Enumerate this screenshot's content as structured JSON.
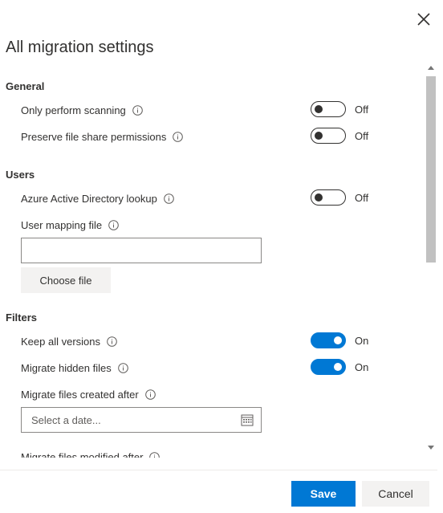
{
  "panel": {
    "title": "All migration settings"
  },
  "general": {
    "heading": "General",
    "only_scanning": {
      "label": "Only perform scanning",
      "state": "Off"
    },
    "preserve_permissions": {
      "label": "Preserve file share permissions",
      "state": "Off"
    }
  },
  "users": {
    "heading": "Users",
    "aad_lookup": {
      "label": "Azure Active Directory lookup",
      "state": "Off"
    },
    "mapping_file": {
      "label": "User mapping file",
      "value": "",
      "choose_button": "Choose file"
    }
  },
  "filters": {
    "heading": "Filters",
    "keep_versions": {
      "label": "Keep all versions",
      "state": "On"
    },
    "migrate_hidden": {
      "label": "Migrate hidden files",
      "state": "On"
    },
    "created_after": {
      "label": "Migrate files created after",
      "placeholder": "Select a date..."
    },
    "modified_after": {
      "label": "Migrate files modified after"
    }
  },
  "footer": {
    "save": "Save",
    "cancel": "Cancel"
  },
  "colors": {
    "accent": "#0078d4",
    "text": "#323130",
    "button_neutral": "#f3f2f1"
  },
  "icons": [
    "close-icon",
    "info-icon",
    "calendar-icon",
    "scroll-up-icon",
    "scroll-down-icon"
  ]
}
